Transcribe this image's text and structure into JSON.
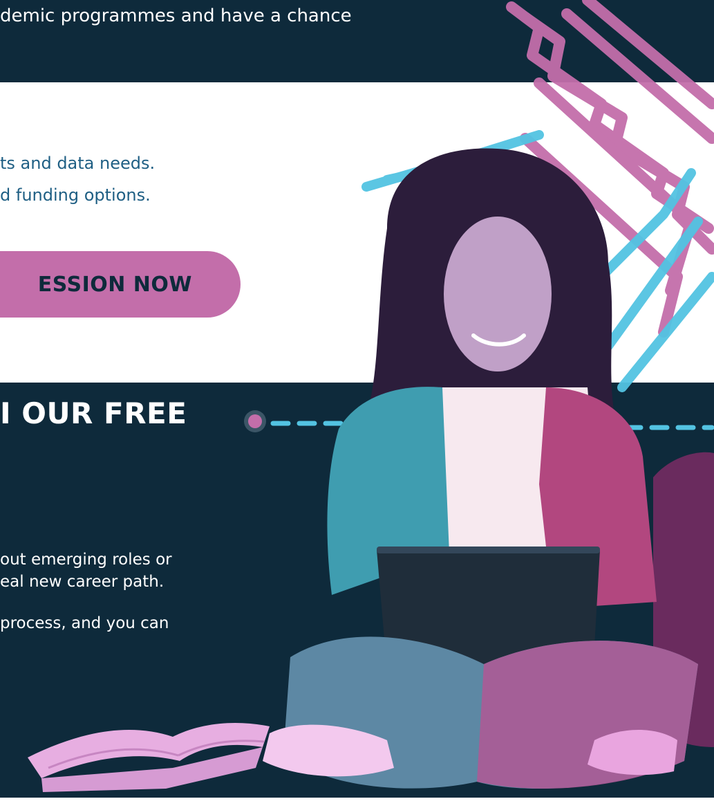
{
  "top": {
    "text": "demic programmes and have a chance"
  },
  "middle": {
    "bullets": [
      "ts and data needs.",
      "d funding options."
    ],
    "cta_label": "ESSION NOW"
  },
  "bottom": {
    "heading": "I OUR FREE",
    "paragraph_lines": [
      "out emerging roles or",
      "eal new career path.",
      "process, and you can"
    ]
  },
  "colors": {
    "navy": "#0e2a3b",
    "pink": "#c36eaa",
    "cyan": "#53c3e2",
    "text_blue": "#1f5f84"
  }
}
